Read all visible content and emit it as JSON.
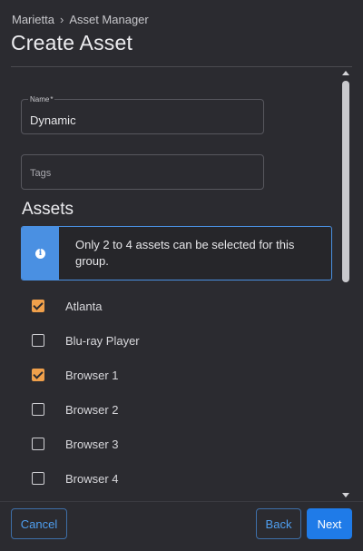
{
  "breadcrumb": {
    "items": [
      "Marietta",
      "Asset Manager"
    ],
    "separator": "›"
  },
  "page_title": "Create Asset",
  "form": {
    "name": {
      "label": "Name",
      "required_mark": "*",
      "value": "Dynamic"
    },
    "tags": {
      "placeholder": "Tags",
      "value": ""
    }
  },
  "assets_section": {
    "title": "Assets",
    "info_icon": "info-icon",
    "info_text": "Only 2 to 4 assets can be selected for this group.",
    "items": [
      {
        "label": "Atlanta",
        "checked": true
      },
      {
        "label": "Blu-ray Player",
        "checked": false
      },
      {
        "label": "Browser 1",
        "checked": true
      },
      {
        "label": "Browser 2",
        "checked": false
      },
      {
        "label": "Browser 3",
        "checked": false
      },
      {
        "label": "Browser 4",
        "checked": false
      },
      {
        "label": "",
        "checked": false
      }
    ]
  },
  "footer": {
    "cancel_label": "Cancel",
    "back_label": "Back",
    "next_label": "Next"
  },
  "colors": {
    "accent": "#1f7be8",
    "info": "#4a90e2",
    "checkbox_checked": "#f0a04b",
    "background": "#2b2b30"
  }
}
